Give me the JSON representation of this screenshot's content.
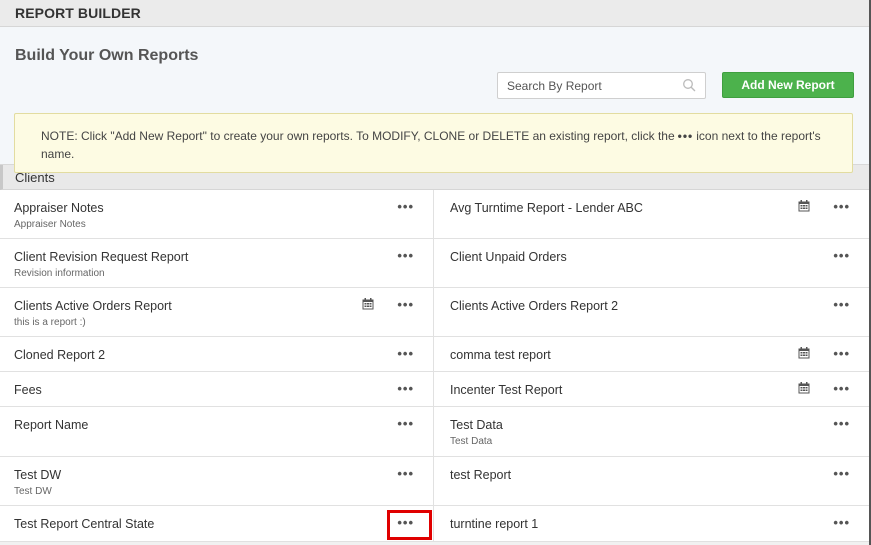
{
  "topbar": {
    "title": "REPORT BUILDER"
  },
  "header": {
    "title": "Build Your Own Reports",
    "search_placeholder": "Search By Report",
    "add_button": "Add New Report"
  },
  "note": {
    "before": "NOTE: Click \"Add New Report\" to create your own reports. To MODIFY, CLONE or DELETE an existing report, click the",
    "dots": "•••",
    "after": "icon next to the report's name."
  },
  "section": {
    "title": "Clients"
  },
  "more_glyph": "•••",
  "rows": [
    {
      "height": 49,
      "left": {
        "name": "Appraiser Notes",
        "desc": "Appraiser Notes",
        "calendar": false
      },
      "right": {
        "name": "Avg Turntime Report - Lender ABC",
        "desc": "",
        "calendar": true
      }
    },
    {
      "height": 49,
      "left": {
        "name": "Client Revision Request Report",
        "desc": "Revision information",
        "calendar": false
      },
      "right": {
        "name": "Client Unpaid Orders",
        "desc": "",
        "calendar": false
      }
    },
    {
      "height": 49,
      "left": {
        "name": "Clients Active Orders Report",
        "desc": "this is a report :)",
        "calendar": true
      },
      "right": {
        "name": "Clients Active Orders Report 2",
        "desc": "",
        "calendar": false
      }
    },
    {
      "height": 35,
      "left": {
        "name": "Cloned Report 2",
        "desc": "",
        "calendar": false
      },
      "right": {
        "name": "comma test report",
        "desc": "",
        "calendar": true
      }
    },
    {
      "height": 35,
      "left": {
        "name": "Fees",
        "desc": "",
        "calendar": false
      },
      "right": {
        "name": "Incenter Test Report",
        "desc": "",
        "calendar": true
      }
    },
    {
      "height": 50,
      "left": {
        "name": "Report Name",
        "desc": "",
        "calendar": false
      },
      "right": {
        "name": "Test Data",
        "desc": "Test Data",
        "calendar": false
      }
    },
    {
      "height": 49,
      "left": {
        "name": "Test DW",
        "desc": "Test DW",
        "calendar": false
      },
      "right": {
        "name": "test Report",
        "desc": "",
        "calendar": false
      }
    },
    {
      "height": 36,
      "left": {
        "name": "Test Report Central State",
        "desc": "",
        "calendar": false
      },
      "right": {
        "name": "turntine report 1",
        "desc": "",
        "calendar": false
      }
    }
  ],
  "colors": {
    "accent": "#4cb24c",
    "highlight": "#e00000",
    "note_bg": "#fdfbe3"
  }
}
